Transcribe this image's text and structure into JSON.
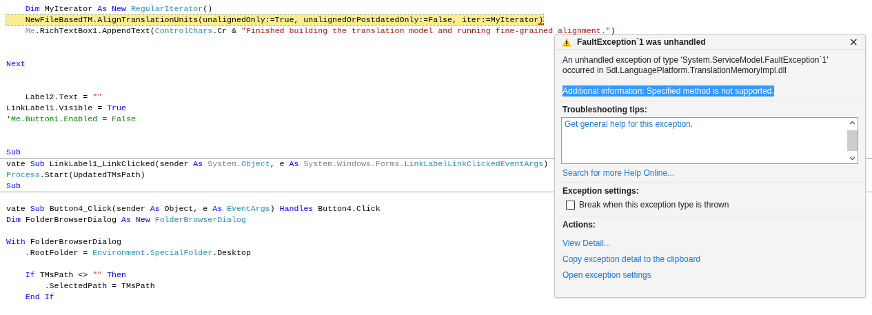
{
  "editor": {
    "lines": [
      {
        "kind": "code",
        "tokens": [
          {
            "kind": "kw",
            "text": "    Dim"
          },
          {
            "kind": "plain",
            "text": " MyIterator "
          },
          {
            "kind": "kw",
            "text": "As New "
          },
          {
            "kind": "type",
            "text": "RegularIterator"
          },
          {
            "kind": "plain",
            "text": "()"
          }
        ]
      },
      {
        "kind": "code",
        "highlighted": true,
        "tokens": [
          {
            "kind": "plain",
            "text": "    NewFileBasedTM.AlignTranslationUnits(unalignedOnly:=True, unalignedOrPostdatedOnly:=False, iter:=MyIterator)"
          }
        ]
      },
      {
        "kind": "code",
        "tokens": [
          {
            "kind": "me",
            "text": "    Me"
          },
          {
            "kind": "plain",
            "text": ".RichTextBox1.AppendText("
          },
          {
            "kind": "type",
            "text": "ControlChars"
          },
          {
            "kind": "plain",
            "text": ".Cr & "
          },
          {
            "kind": "str",
            "text": "\"Finished building the translation model and running fine-grained alignment.\""
          },
          {
            "kind": "plain",
            "text": ")"
          }
        ]
      },
      {
        "kind": "blank"
      },
      {
        "kind": "blank"
      },
      {
        "kind": "code",
        "tokens": [
          {
            "kind": "kw",
            "text": "Next"
          }
        ]
      },
      {
        "kind": "blank"
      },
      {
        "kind": "blank"
      },
      {
        "kind": "code",
        "tokens": [
          {
            "kind": "plain",
            "text": "    Label2.Text = "
          },
          {
            "kind": "str",
            "text": "\"\""
          }
        ]
      },
      {
        "kind": "code",
        "tokens": [
          {
            "kind": "plain",
            "text": "LinkLabel1.Visible = "
          },
          {
            "kind": "kw",
            "text": "True"
          }
        ]
      },
      {
        "kind": "code",
        "tokens": [
          {
            "kind": "cmt",
            "text": "'Me.Button1.Enabled = False"
          }
        ]
      },
      {
        "kind": "blank"
      },
      {
        "kind": "blank"
      },
      {
        "kind": "code",
        "tokens": [
          {
            "kind": "kw",
            "text": "Sub"
          }
        ]
      },
      {
        "kind": "separator"
      },
      {
        "kind": "code",
        "tokens": [
          {
            "kind": "plain",
            "text": "vate "
          },
          {
            "kind": "kw",
            "text": "Sub"
          },
          {
            "kind": "plain",
            "text": " LinkLabel1_LinkClicked(sender "
          },
          {
            "kind": "kw",
            "text": "As "
          },
          {
            "kind": "dim",
            "text": "System."
          },
          {
            "kind": "type",
            "text": "Object"
          },
          {
            "kind": "plain",
            "text": ", e "
          },
          {
            "kind": "kw",
            "text": "As "
          },
          {
            "kind": "dim",
            "text": "System.Windows.Forms."
          },
          {
            "kind": "type",
            "text": "LinkLabelLinkClickedEventArgs"
          },
          {
            "kind": "plain",
            "text": ")"
          }
        ]
      },
      {
        "kind": "code",
        "tokens": [
          {
            "kind": "type",
            "text": "Process"
          },
          {
            "kind": "plain",
            "text": ".Start(UpdatedTMsPath)"
          }
        ]
      },
      {
        "kind": "code",
        "tokens": [
          {
            "kind": "kw",
            "text": "Sub"
          }
        ]
      },
      {
        "kind": "separator"
      },
      {
        "kind": "blank"
      },
      {
        "kind": "code",
        "tokens": [
          {
            "kind": "plain",
            "text": "vate "
          },
          {
            "kind": "kw",
            "text": "Sub"
          },
          {
            "kind": "plain",
            "text": " Button4_Click(sender "
          },
          {
            "kind": "kw",
            "text": "As"
          },
          {
            "kind": "plain",
            "text": " Object, e "
          },
          {
            "kind": "kw",
            "text": "As "
          },
          {
            "kind": "type",
            "text": "EventArgs"
          },
          {
            "kind": "plain",
            "text": ") "
          },
          {
            "kind": "kw",
            "text": "Handles"
          },
          {
            "kind": "plain",
            "text": " Button4.Click"
          }
        ]
      },
      {
        "kind": "code",
        "tokens": [
          {
            "kind": "kw",
            "text": "Dim"
          },
          {
            "kind": "plain",
            "text": " FolderBrowserDialog "
          },
          {
            "kind": "kw",
            "text": "As New "
          },
          {
            "kind": "type",
            "text": "FolderBrowserDialog"
          }
        ]
      },
      {
        "kind": "blank"
      },
      {
        "kind": "code",
        "tokens": [
          {
            "kind": "kw",
            "text": "With"
          },
          {
            "kind": "plain",
            "text": " FolderBrowserDialog"
          }
        ]
      },
      {
        "kind": "code",
        "tokens": [
          {
            "kind": "plain",
            "text": "    .RootFolder = "
          },
          {
            "kind": "type",
            "text": "Environment"
          },
          {
            "kind": "plain",
            "text": "."
          },
          {
            "kind": "type",
            "text": "SpecialFolder"
          },
          {
            "kind": "plain",
            "text": ".Desktop"
          }
        ]
      },
      {
        "kind": "blank"
      },
      {
        "kind": "code",
        "tokens": [
          {
            "kind": "kw",
            "text": "    If"
          },
          {
            "kind": "plain",
            "text": " TMsPath <> "
          },
          {
            "kind": "str",
            "text": "\"\""
          },
          {
            "kind": "kw",
            "text": " Then"
          }
        ]
      },
      {
        "kind": "code",
        "tokens": [
          {
            "kind": "plain",
            "text": "        .SelectedPath = TMsPath"
          }
        ]
      },
      {
        "kind": "code",
        "tokens": [
          {
            "kind": "kw",
            "text": "    End If"
          }
        ]
      }
    ]
  },
  "exception_popup": {
    "title": "FaultException`1 was unhandled",
    "close": "×",
    "message": "An unhandled exception of type 'System.ServiceModel.FaultException`1' occurred in Sdl.LanguagePlatform.TranslationMemoryImpl.dll",
    "additional_info": {
      "text": "Additional information: Specified method is not supported.",
      "selected": true
    },
    "troubleshooting": {
      "heading": "Troubleshooting tips:",
      "tips": [
        "Get general help for this exception."
      ],
      "search_link": "Search for more Help Online..."
    },
    "settings": {
      "heading": "Exception settings:",
      "checkbox": {
        "label": "Break when this exception type is thrown",
        "checked": false
      }
    },
    "actions": {
      "heading": "Actions:",
      "links": [
        "View Detail...",
        "Copy exception detail to the clipboard",
        "Open exception settings"
      ]
    }
  }
}
